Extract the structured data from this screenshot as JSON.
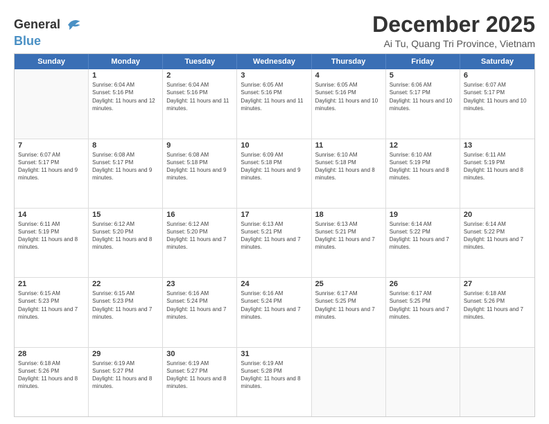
{
  "header": {
    "logo_line1": "General",
    "logo_line2": "Blue",
    "month": "December 2025",
    "location": "Ai Tu, Quang Tri Province, Vietnam"
  },
  "days_of_week": [
    "Sunday",
    "Monday",
    "Tuesday",
    "Wednesday",
    "Thursday",
    "Friday",
    "Saturday"
  ],
  "weeks": [
    [
      {
        "day": "",
        "empty": true
      },
      {
        "day": "1",
        "sunrise": "6:04 AM",
        "sunset": "5:16 PM",
        "daylight": "11 hours and 12 minutes."
      },
      {
        "day": "2",
        "sunrise": "6:04 AM",
        "sunset": "5:16 PM",
        "daylight": "11 hours and 11 minutes."
      },
      {
        "day": "3",
        "sunrise": "6:05 AM",
        "sunset": "5:16 PM",
        "daylight": "11 hours and 11 minutes."
      },
      {
        "day": "4",
        "sunrise": "6:05 AM",
        "sunset": "5:16 PM",
        "daylight": "11 hours and 10 minutes."
      },
      {
        "day": "5",
        "sunrise": "6:06 AM",
        "sunset": "5:17 PM",
        "daylight": "11 hours and 10 minutes."
      },
      {
        "day": "6",
        "sunrise": "6:07 AM",
        "sunset": "5:17 PM",
        "daylight": "11 hours and 10 minutes."
      }
    ],
    [
      {
        "day": "7",
        "sunrise": "6:07 AM",
        "sunset": "5:17 PM",
        "daylight": "11 hours and 9 minutes."
      },
      {
        "day": "8",
        "sunrise": "6:08 AM",
        "sunset": "5:17 PM",
        "daylight": "11 hours and 9 minutes."
      },
      {
        "day": "9",
        "sunrise": "6:08 AM",
        "sunset": "5:18 PM",
        "daylight": "11 hours and 9 minutes."
      },
      {
        "day": "10",
        "sunrise": "6:09 AM",
        "sunset": "5:18 PM",
        "daylight": "11 hours and 9 minutes."
      },
      {
        "day": "11",
        "sunrise": "6:10 AM",
        "sunset": "5:18 PM",
        "daylight": "11 hours and 8 minutes."
      },
      {
        "day": "12",
        "sunrise": "6:10 AM",
        "sunset": "5:19 PM",
        "daylight": "11 hours and 8 minutes."
      },
      {
        "day": "13",
        "sunrise": "6:11 AM",
        "sunset": "5:19 PM",
        "daylight": "11 hours and 8 minutes."
      }
    ],
    [
      {
        "day": "14",
        "sunrise": "6:11 AM",
        "sunset": "5:19 PM",
        "daylight": "11 hours and 8 minutes."
      },
      {
        "day": "15",
        "sunrise": "6:12 AM",
        "sunset": "5:20 PM",
        "daylight": "11 hours and 8 minutes."
      },
      {
        "day": "16",
        "sunrise": "6:12 AM",
        "sunset": "5:20 PM",
        "daylight": "11 hours and 7 minutes."
      },
      {
        "day": "17",
        "sunrise": "6:13 AM",
        "sunset": "5:21 PM",
        "daylight": "11 hours and 7 minutes."
      },
      {
        "day": "18",
        "sunrise": "6:13 AM",
        "sunset": "5:21 PM",
        "daylight": "11 hours and 7 minutes."
      },
      {
        "day": "19",
        "sunrise": "6:14 AM",
        "sunset": "5:22 PM",
        "daylight": "11 hours and 7 minutes."
      },
      {
        "day": "20",
        "sunrise": "6:14 AM",
        "sunset": "5:22 PM",
        "daylight": "11 hours and 7 minutes."
      }
    ],
    [
      {
        "day": "21",
        "sunrise": "6:15 AM",
        "sunset": "5:23 PM",
        "daylight": "11 hours and 7 minutes."
      },
      {
        "day": "22",
        "sunrise": "6:15 AM",
        "sunset": "5:23 PM",
        "daylight": "11 hours and 7 minutes."
      },
      {
        "day": "23",
        "sunrise": "6:16 AM",
        "sunset": "5:24 PM",
        "daylight": "11 hours and 7 minutes."
      },
      {
        "day": "24",
        "sunrise": "6:16 AM",
        "sunset": "5:24 PM",
        "daylight": "11 hours and 7 minutes."
      },
      {
        "day": "25",
        "sunrise": "6:17 AM",
        "sunset": "5:25 PM",
        "daylight": "11 hours and 7 minutes."
      },
      {
        "day": "26",
        "sunrise": "6:17 AM",
        "sunset": "5:25 PM",
        "daylight": "11 hours and 7 minutes."
      },
      {
        "day": "27",
        "sunrise": "6:18 AM",
        "sunset": "5:26 PM",
        "daylight": "11 hours and 7 minutes."
      }
    ],
    [
      {
        "day": "28",
        "sunrise": "6:18 AM",
        "sunset": "5:26 PM",
        "daylight": "11 hours and 8 minutes."
      },
      {
        "day": "29",
        "sunrise": "6:19 AM",
        "sunset": "5:27 PM",
        "daylight": "11 hours and 8 minutes."
      },
      {
        "day": "30",
        "sunrise": "6:19 AM",
        "sunset": "5:27 PM",
        "daylight": "11 hours and 8 minutes."
      },
      {
        "day": "31",
        "sunrise": "6:19 AM",
        "sunset": "5:28 PM",
        "daylight": "11 hours and 8 minutes."
      },
      {
        "day": "",
        "empty": true
      },
      {
        "day": "",
        "empty": true
      },
      {
        "day": "",
        "empty": true
      }
    ]
  ]
}
